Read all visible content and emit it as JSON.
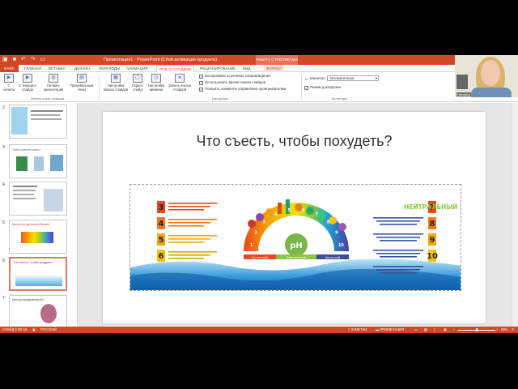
{
  "colors": {
    "accent": "#d24726",
    "context": "#e6725a"
  },
  "window": {
    "title": "Презентация1 - PowerPoint (Сбой активации продукта)",
    "context_group": "РАБОТА С РИСУНКАМИ"
  },
  "quick_access": {
    "save_icon": "save-icon",
    "undo_icon": "undo-icon",
    "redo_icon": "redo-icon",
    "start_icon": "start-slideshow-icon"
  },
  "tabs": [
    "ФАЙЛ",
    "ГЛАВНАЯ",
    "ВСТАВКА",
    "ДИЗАЙН",
    "ПЕРЕХОДЫ",
    "АНИМАЦИЯ",
    "ПОКАЗ СЛАЙДОВ",
    "РЕЦЕНЗИРОВАНИЕ",
    "ВИД",
    "ФОРМАТ"
  ],
  "ribbon": {
    "btn_from_start": "С начала",
    "btn_from_current": "С текущего слайда",
    "btn_online": "Онлайн-презентация",
    "btn_custom": "Произвольный показ",
    "group_start": "Начать показ слайдов",
    "btn_setup": "Настройка показа слайдов",
    "btn_hide": "Скрыть слайд",
    "btn_rehearse": "Настройка времени",
    "btn_record": "Запись показа слайдов",
    "chk_narration": "Воспроизвести речевое сопровождение",
    "chk_timings": "Использовать время показа слайдов",
    "chk_controls": "Показать элементы управления проигрывателем",
    "group_setup": "Настройка",
    "monitor_label": "Монитор:",
    "monitor_value": "Автоматически",
    "chk_presenter": "Режим докладчика",
    "group_monitors": "Мониторы"
  },
  "webcam": {
    "name": "Наталья"
  },
  "slides": [
    {
      "num": "2",
      "title": ""
    },
    {
      "num": "3",
      "title": "Пить или не пить?"
    },
    {
      "num": "4",
      "title": ""
    },
    {
      "num": "5",
      "title": "Кислотно-щелочной баланс"
    },
    {
      "num": "6",
      "title": "Что съесть, чтобы похудеть?"
    },
    {
      "num": "7",
      "title": "Метод определения pH"
    }
  ],
  "current_slide": {
    "title": "Что съесть, чтобы похудеть?",
    "infographic": {
      "right_heading": "НЕЙТРАЛЬНЫЙ PH",
      "left_numbers": [
        "3",
        "4",
        "5",
        "6"
      ],
      "right_numbers": [
        "7",
        "8",
        "9",
        "10"
      ],
      "scale_numbers": [
        "1",
        "2",
        "3",
        "4",
        "5",
        "6",
        "7",
        "8",
        "9",
        "10"
      ],
      "left_colors": [
        "#e8481f",
        "#f07a1a",
        "#f5a800",
        "#f3c300"
      ],
      "right_colors": [
        "#e8481f",
        "#f07a1a",
        "#f5a800",
        "#f3c300"
      ],
      "badge": "pH",
      "bar_labels": [
        "Кислотный",
        "Нейтральный",
        "Щелочной"
      ]
    }
  },
  "status": {
    "slide_counter": "СЛАЙД 6 ИЗ 18",
    "language": "РУССКИЙ",
    "notes": "ЗАМЕТКИ",
    "comments": "ПРИМЕЧАНИЯ",
    "zoom": "89%"
  }
}
